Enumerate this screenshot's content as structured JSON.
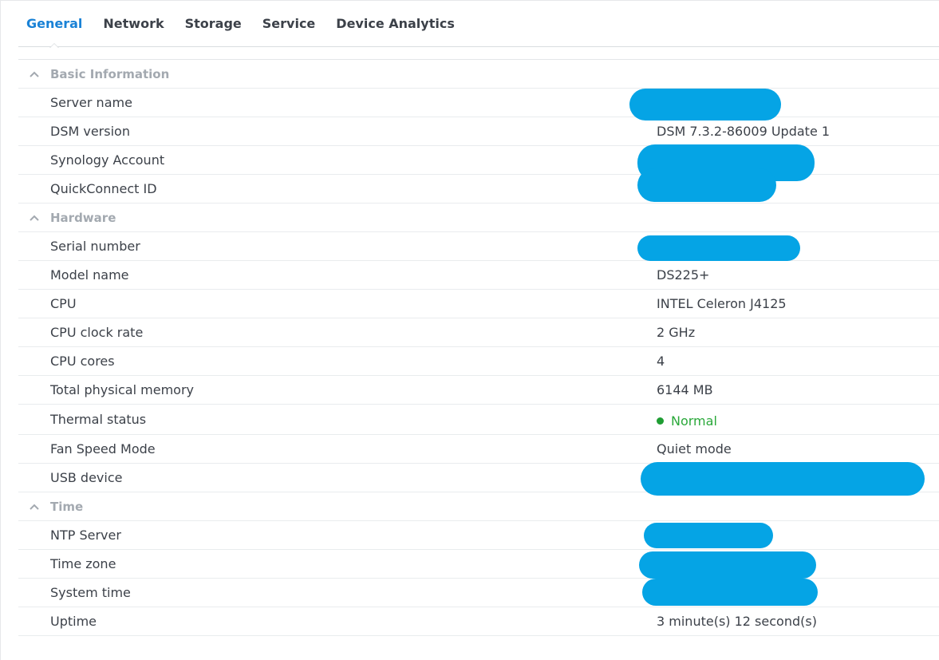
{
  "tabs": [
    {
      "label": "General",
      "active": true
    },
    {
      "label": "Network",
      "active": false
    },
    {
      "label": "Storage",
      "active": false
    },
    {
      "label": "Service",
      "active": false
    },
    {
      "label": "Device Analytics",
      "active": false
    }
  ],
  "sections": {
    "basic": {
      "title": "Basic Information",
      "rows": {
        "server_name": {
          "label": "Server name",
          "value": ""
        },
        "dsm_version": {
          "label": "DSM version",
          "value": "DSM 7.3.2-86009 Update 1"
        },
        "synology_account": {
          "label": "Synology Account",
          "value": ""
        },
        "quickconnect_id": {
          "label": "QuickConnect ID",
          "value": ""
        }
      }
    },
    "hardware": {
      "title": "Hardware",
      "rows": {
        "serial_number": {
          "label": "Serial number",
          "value": ""
        },
        "model_name": {
          "label": "Model name",
          "value": "DS225+"
        },
        "cpu": {
          "label": "CPU",
          "value": "INTEL Celeron J4125"
        },
        "cpu_clock": {
          "label": "CPU clock rate",
          "value": "2 GHz"
        },
        "cpu_cores": {
          "label": "CPU cores",
          "value": "4"
        },
        "memory": {
          "label": "Total physical memory",
          "value": "6144 MB"
        },
        "thermal": {
          "label": "Thermal status",
          "value": "Normal",
          "status_color": "#2aa83a"
        },
        "fan": {
          "label": "Fan Speed Mode",
          "value": "Quiet mode"
        },
        "usb": {
          "label": "USB device",
          "value": ""
        }
      }
    },
    "time": {
      "title": "Time",
      "rows": {
        "ntp": {
          "label": "NTP Server",
          "value": ""
        },
        "timezone": {
          "label": "Time zone",
          "value": ""
        },
        "system_time": {
          "label": "System time",
          "value": ""
        },
        "uptime": {
          "label": "Uptime",
          "value": "3 minute(s) 12 second(s)"
        }
      }
    }
  },
  "colors": {
    "accent": "#1a82d6",
    "redaction": "#05a4e5",
    "status_ok": "#2aa83a"
  },
  "icons": {
    "section_toggle": "chevron-up-icon",
    "status": "status-dot-icon"
  }
}
